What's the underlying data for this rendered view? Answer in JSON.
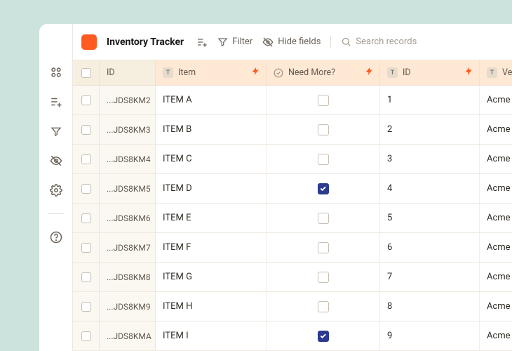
{
  "header": {
    "title": "Inventory Tracker",
    "filter_label": "Filter",
    "hide_fields_label": "Hide fields",
    "search_placeholder": "Search records"
  },
  "columns": {
    "id": "ID",
    "item": "Item",
    "need_more": "Need More?",
    "id2": "ID",
    "vendor_truncated": "Ve"
  },
  "rows": [
    {
      "id": "...JDS8KM2",
      "item": "ITEM A",
      "need": false,
      "id2": "1",
      "vendor": "Acme"
    },
    {
      "id": "...JDS8KM3",
      "item": "ITEM B",
      "need": false,
      "id2": "2",
      "vendor": "Acme"
    },
    {
      "id": "...JDS8KM4",
      "item": "ITEM C",
      "need": false,
      "id2": "3",
      "vendor": "Acme"
    },
    {
      "id": "...JDS8KM5",
      "item": "ITEM D",
      "need": true,
      "id2": "4",
      "vendor": "Acme"
    },
    {
      "id": "...JDS8KM6",
      "item": "ITEM E",
      "need": false,
      "id2": "5",
      "vendor": "Acme"
    },
    {
      "id": "...JDS8KM7",
      "item": "ITEM F",
      "need": false,
      "id2": "6",
      "vendor": "Acme"
    },
    {
      "id": "...JDS8KM8",
      "item": "ITEM G",
      "need": false,
      "id2": "7",
      "vendor": "Acme"
    },
    {
      "id": "...JDS8KM9",
      "item": "ITEM H",
      "need": false,
      "id2": "8",
      "vendor": "Acme"
    },
    {
      "id": "...JDS8KMA",
      "item": "ITEM I",
      "need": true,
      "id2": "9",
      "vendor": "Acme"
    }
  ]
}
